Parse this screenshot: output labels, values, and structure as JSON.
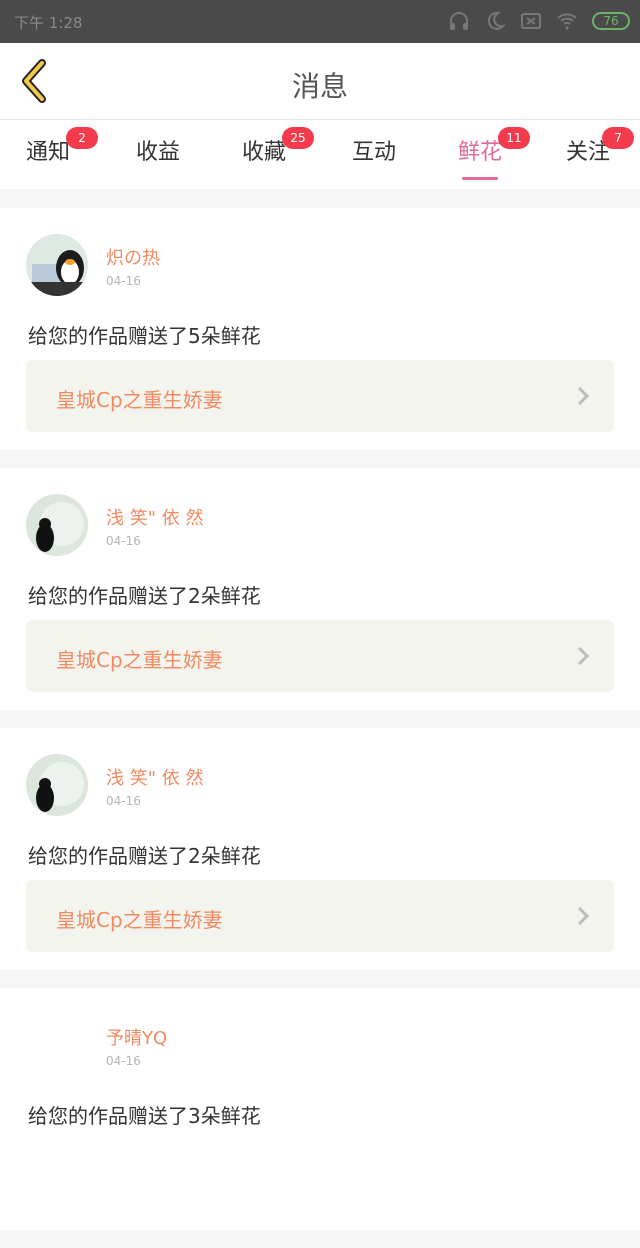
{
  "status": {
    "time": "下午 1:28",
    "battery": "76"
  },
  "header": {
    "title": "消息",
    "back_icon": "chevron-left-icon"
  },
  "tabs": [
    {
      "label": "通知",
      "badge": "2"
    },
    {
      "label": "收益",
      "badge": ""
    },
    {
      "label": "收藏",
      "badge": "25"
    },
    {
      "label": "互动",
      "badge": ""
    },
    {
      "label": "鲜花",
      "badge": "11",
      "active": true
    },
    {
      "label": "关注",
      "badge": "7"
    }
  ],
  "messages": [
    {
      "user": "炽の热",
      "date": "04-16",
      "text": "给您的作品赠送了5朵鲜花",
      "work": "皇城Cp之重生娇妻"
    },
    {
      "user": "浅 笑\" 依 然",
      "date": "04-16",
      "text": "给您的作品赠送了2朵鲜花",
      "work": "皇城Cp之重生娇妻"
    },
    {
      "user": "浅 笑\" 依 然",
      "date": "04-16",
      "text": "给您的作品赠送了2朵鲜花",
      "work": "皇城Cp之重生娇妻"
    },
    {
      "user": "予晴YQ",
      "date": "04-16",
      "text": "给您的作品赠送了3朵鲜花",
      "work": ""
    }
  ]
}
